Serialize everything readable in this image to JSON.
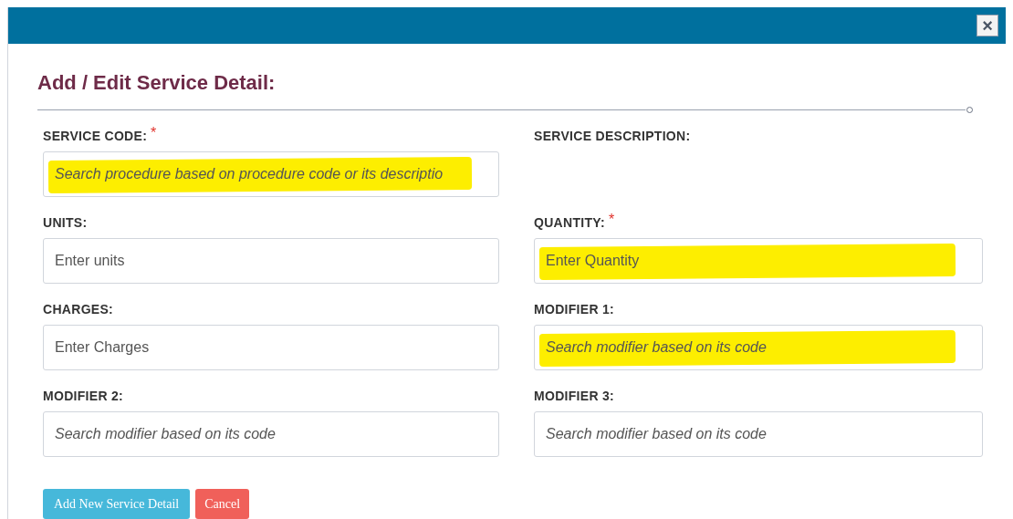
{
  "dialog": {
    "title": "Add / Edit Service Detail:",
    "close": "×"
  },
  "fields": [
    {
      "kind": "field",
      "label": "SERVICE CODE:",
      "required_mark": "*",
      "placeholder": "Search procedure based on procedure code or its descriptio",
      "italic": true,
      "highlighted": true
    },
    {
      "kind": "label",
      "label": "SERVICE DESCRIPTION:"
    },
    {
      "kind": "field",
      "label": "UNITS:",
      "placeholder": "Enter units",
      "italic": false,
      "highlighted": false
    },
    {
      "kind": "field",
      "label": "QUANTITY:",
      "required_mark": "*",
      "placeholder": "Enter Quantity",
      "italic": false,
      "highlighted": true
    },
    {
      "kind": "field",
      "label": "CHARGES:",
      "placeholder": "Enter Charges",
      "italic": false,
      "highlighted": false
    },
    {
      "kind": "field",
      "label": "MODIFIER 1:",
      "placeholder": "Search modifier based on its code",
      "italic": true,
      "highlighted": true
    },
    {
      "kind": "field",
      "label": "MODIFIER 2:",
      "placeholder": "Search modifier based on its code",
      "italic": true,
      "highlighted": false
    },
    {
      "kind": "field",
      "label": "MODIFIER 3:",
      "placeholder": "Search modifier based on its code",
      "italic": true,
      "highlighted": false
    }
  ],
  "buttons": [
    {
      "kind": "primary",
      "label": "Add New Service Detail"
    },
    {
      "kind": "danger",
      "label": "Cancel"
    }
  ]
}
